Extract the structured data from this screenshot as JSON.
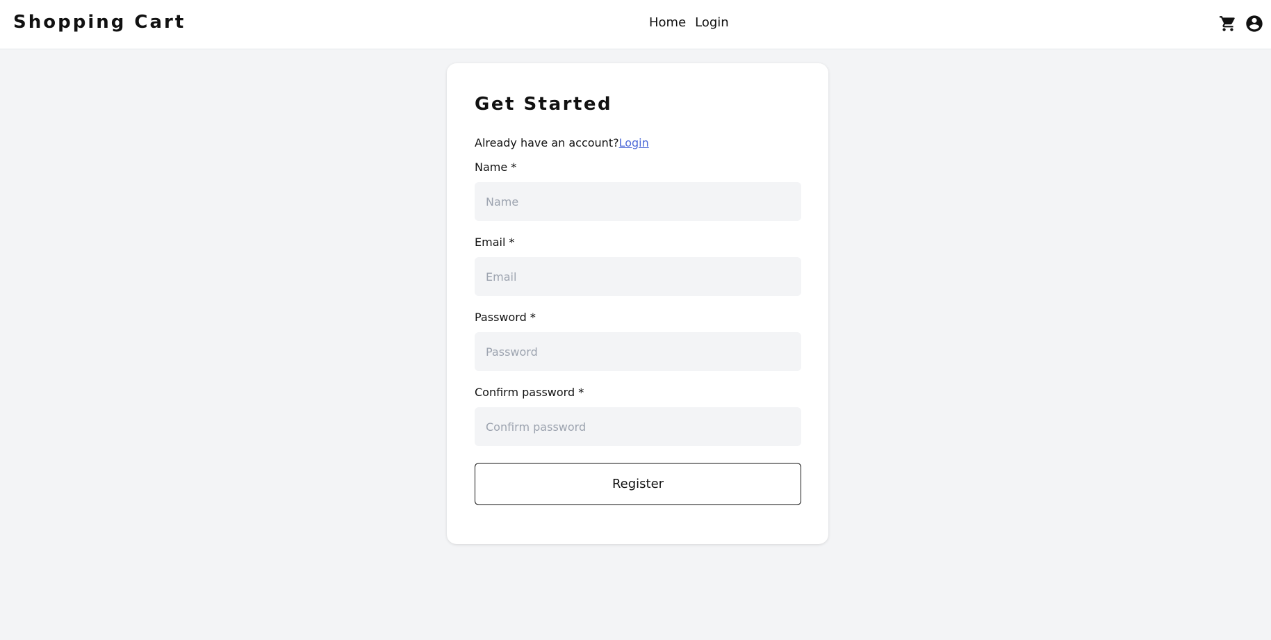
{
  "navbar": {
    "brand": "Shopping Cart",
    "links": [
      "Home",
      "Login"
    ],
    "icons": [
      "cart-icon",
      "account-icon"
    ]
  },
  "form": {
    "title": "Get Started",
    "prompt_text": "Already have an account?",
    "prompt_link": "Login",
    "fields": [
      {
        "label": "Name *",
        "placeholder": "Name",
        "value": ""
      },
      {
        "label": "Email *",
        "placeholder": "Email",
        "value": ""
      },
      {
        "label": "Password *",
        "placeholder": "Password",
        "value": ""
      },
      {
        "label": "Confirm password *",
        "placeholder": "Confirm password",
        "value": ""
      }
    ],
    "submit_label": "Register"
  },
  "colors": {
    "background": "#f3f4f6",
    "card": "#ffffff",
    "link": "#4f6bd8",
    "input_bg": "#f3f4f6"
  }
}
